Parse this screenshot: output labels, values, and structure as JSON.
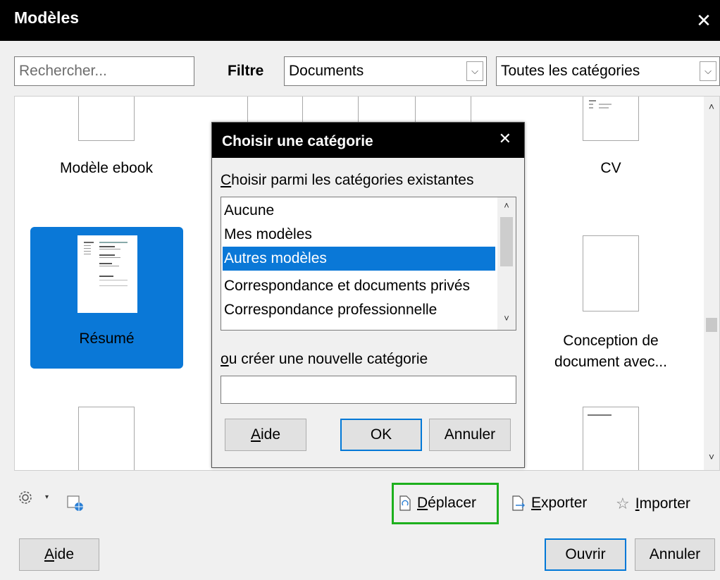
{
  "window": {
    "title": "Modèles",
    "close_glyph": "✕"
  },
  "toolbar": {
    "search_placeholder": "Rechercher...",
    "filter_label": "Filtre",
    "filter_value": "Documents",
    "category_value": "Toutes les catégories",
    "chevron_glyph": "⌵"
  },
  "templates": [
    {
      "label": "Modèle ebook"
    },
    {
      "label": "CV"
    },
    {
      "label": "Résumé",
      "selected": true
    },
    {
      "label_line1": "Conception de",
      "label_line2": "document avec..."
    }
  ],
  "scroll": {
    "up": "˄",
    "down": "˅"
  },
  "dialog": {
    "title": "Choisir une catégorie",
    "close_glyph": "✕",
    "existing_label_first": "C",
    "existing_label_rest": "hoisir parmi les catégories existantes",
    "categories": [
      "Aucune",
      "Mes modèles",
      "Autres modèles",
      "Correspondance et documents privés",
      "Correspondance professionnelle"
    ],
    "selected_index": 2,
    "new_label_first": "o",
    "new_label_rest": "u créer une nouvelle catégorie",
    "new_value": "",
    "help_first": "A",
    "help_rest": "ide",
    "ok": "OK",
    "cancel": "Annuler"
  },
  "bottom": {
    "move_first": "D",
    "move_rest": "éplacer",
    "export_first": "E",
    "export_rest": "xporter",
    "import_first": "I",
    "import_rest": "mporter",
    "star_glyph": "☆",
    "caret_glyph": "▾"
  },
  "footer": {
    "help_first": "A",
    "help_rest": "ide",
    "open": "Ouvrir",
    "cancel": "Annuler"
  },
  "colors": {
    "accent": "#0a78d7",
    "highlight": "#1db01d",
    "titlebar": "#000000"
  }
}
